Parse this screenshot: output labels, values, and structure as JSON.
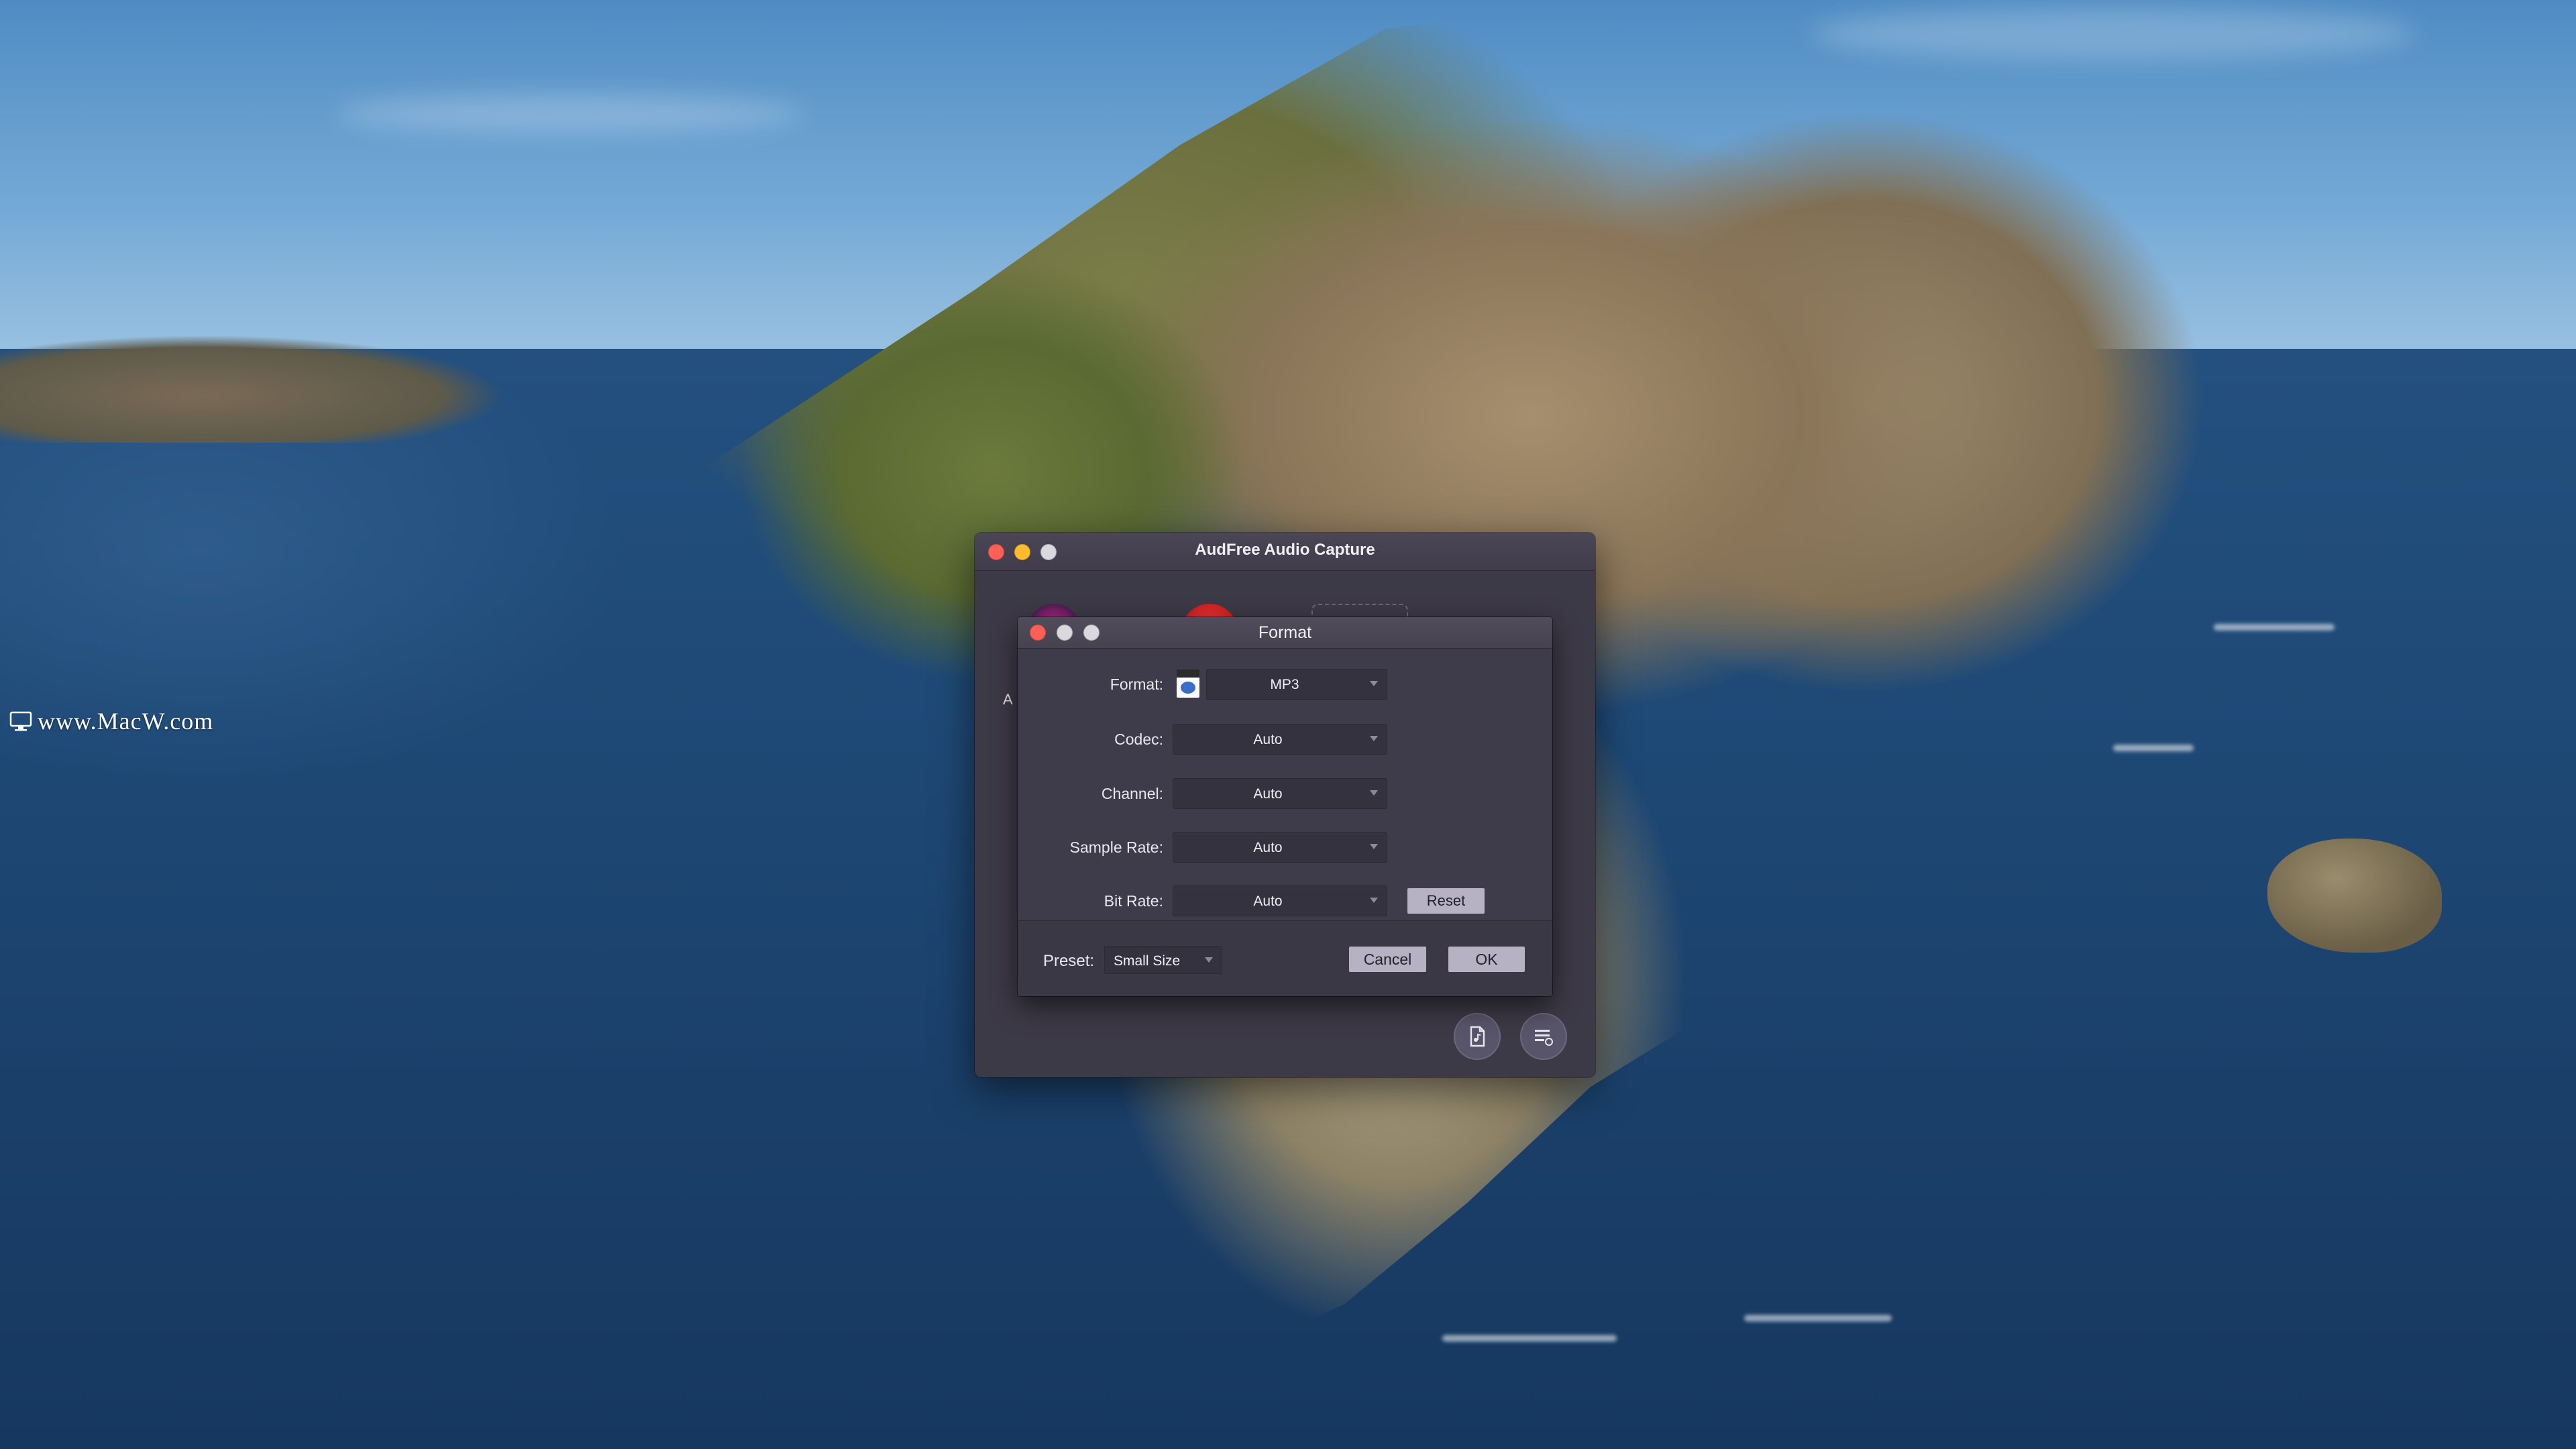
{
  "watermark": {
    "text": "www.MacW.com"
  },
  "app_window": {
    "title": "AudFree Audio Capture",
    "source_label_fragment": "A"
  },
  "format_dialog": {
    "title": "Format",
    "fields": [
      {
        "label": "Format:",
        "value": "MP3"
      },
      {
        "label": "Codec:",
        "value": "Auto"
      },
      {
        "label": "Channel:",
        "value": "Auto"
      },
      {
        "label": "Sample Rate:",
        "value": "Auto"
      },
      {
        "label": "Bit Rate:",
        "value": "Auto"
      }
    ],
    "reset_label": "Reset",
    "preset_label": "Preset:",
    "preset_value": "Small Size",
    "cancel_label": "Cancel",
    "ok_label": "OK"
  },
  "colors": {
    "close": "#fe5f57",
    "minimize": "#febc2e",
    "zoom_inactive": "#d9d9de",
    "window_bg": "#3d3a47",
    "button_bg": "#b6b2c4"
  },
  "icons": {
    "watermark": "monitor-icon",
    "format_file": "mp3-file-icon",
    "bottom_left": "file-audio-icon",
    "bottom_right": "list-settings-icon"
  }
}
